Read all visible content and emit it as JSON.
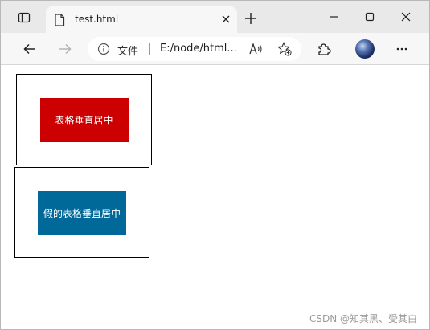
{
  "tab": {
    "title": "test.html"
  },
  "address_bar": {
    "label": "文件",
    "url": "E:/node/html..."
  },
  "content": {
    "table_box_label": "表格垂直居中",
    "fake_table_box_label": "假的表格垂直居中"
  },
  "watermark": "CSDN @知其黑、受其白",
  "colors": {
    "red_box": "#cc0000",
    "blue_box": "#00699a"
  }
}
